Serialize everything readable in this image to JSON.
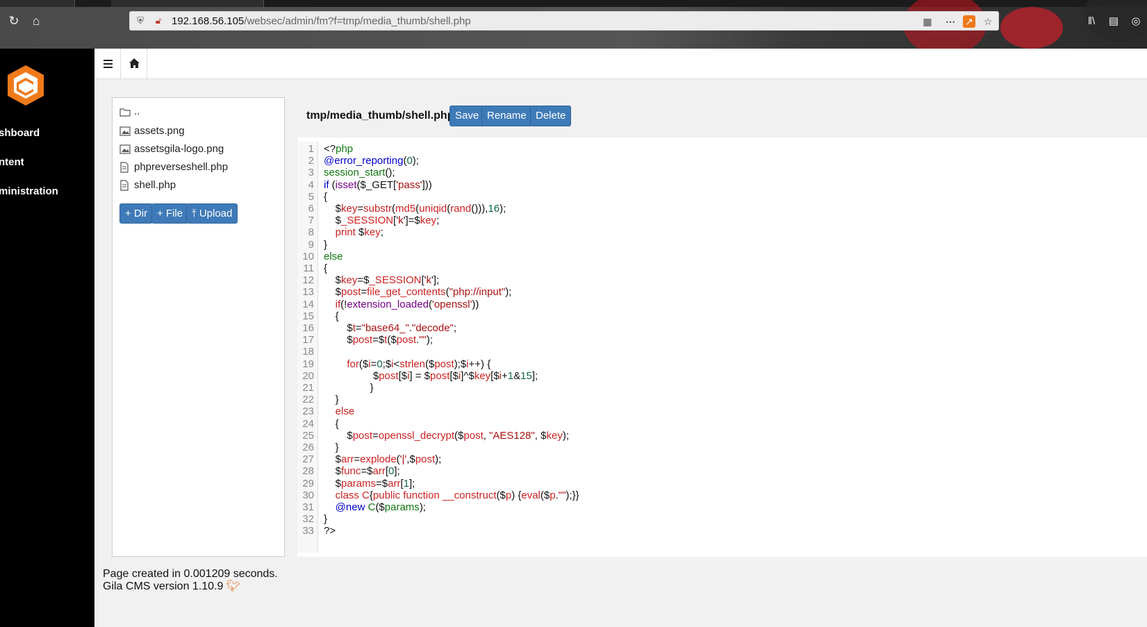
{
  "browser": {
    "url_host": "192.168.56.105",
    "url_path": "/websec/admin/fm?f=tmp/media_thumb/shell.php"
  },
  "sidebar": {
    "items": [
      {
        "label": "shboard"
      },
      {
        "label": "ntent"
      },
      {
        "label": "ministration"
      }
    ]
  },
  "file_panel": {
    "parent": "..",
    "files": [
      "assets.png",
      "assetsgila-logo.png",
      "phpreverseshell.php",
      "shell.php"
    ],
    "buttons": {
      "add_dir": "+ Dir",
      "add_file": "+ File",
      "upload": "Upload"
    }
  },
  "editor": {
    "file_title": "tmp/media_thumb/shell.php",
    "buttons": {
      "save": "Save",
      "rename": "Rename",
      "delete": "Delete"
    },
    "line_count": 33
  },
  "footer": {
    "timing": "Page created in 0.001209 seconds.",
    "version": "Gila CMS version 1.10.9"
  },
  "colors": {
    "accent_button": "#3f7ab8",
    "logo_orange": "#f07a1a",
    "sidebar_bg": "#000000"
  }
}
